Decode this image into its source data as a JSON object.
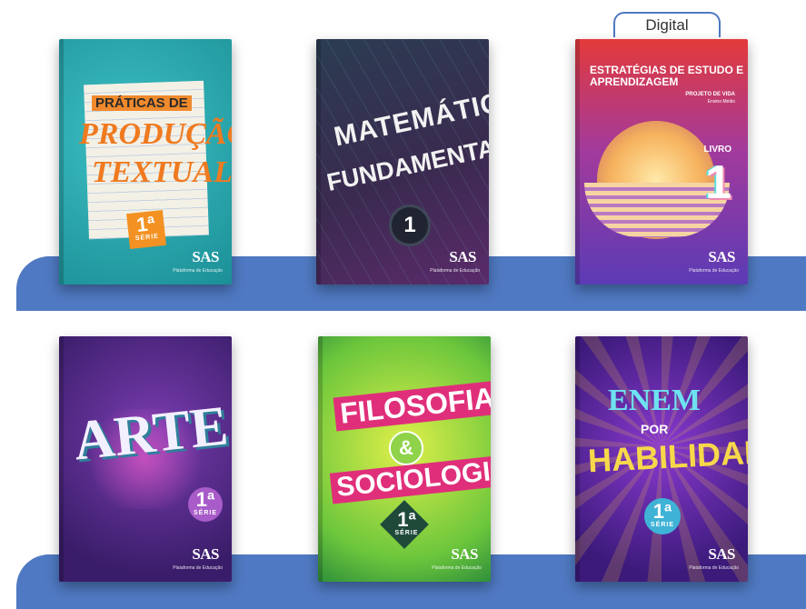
{
  "badges": {
    "digital": "Digital"
  },
  "brand": {
    "name": "SAS",
    "tagline": "Plataforma de Educação"
  },
  "books": [
    {
      "title_line1": "PRÁTICAS DE",
      "title_line2": "PRODUÇÃO",
      "title_line3": "TEXTUAL",
      "grade": "1ª",
      "grade_label": "SÉRIE"
    },
    {
      "title_line1": "MATEMÁTICA",
      "title_line2": "FUNDAMENTAL",
      "volume": "1"
    },
    {
      "title": "ESTRATÉGIAS DE ESTUDO E APRENDIZAGEM",
      "subtitle": "PROJETO DE VIDA",
      "level": "Ensino Médio",
      "book_label": "LIVRO",
      "volume": "1"
    },
    {
      "title": "ARTE",
      "grade": "1ª",
      "grade_label": "SÉRIE"
    },
    {
      "title_line1": "FILOSOFIA",
      "connector": "&",
      "title_line2": "SOCIOLOGIA",
      "grade": "1ª",
      "grade_label": "SÉRIE"
    },
    {
      "title_line1": "ENEM",
      "title_line2": "POR",
      "title_line3": "HABILIDADES",
      "grade": "1ª",
      "grade_label": "SÉRIE"
    }
  ]
}
